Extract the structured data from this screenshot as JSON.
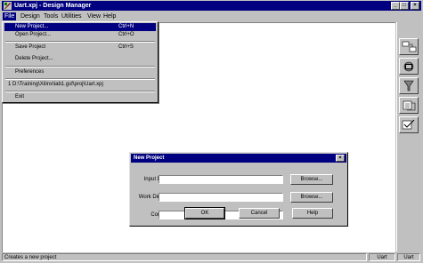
{
  "app": {
    "title": "Uart.xpj - Design Manager"
  },
  "menubar": {
    "items": [
      "File",
      "Design",
      "Tools",
      "Utilities",
      "View",
      "Help"
    ],
    "active_index": 0
  },
  "file_menu": {
    "items": [
      {
        "label": "New Project...",
        "shortcut": "Ctrl+N"
      },
      {
        "label": "Open Project...",
        "shortcut": "Ctrl+O"
      },
      {
        "label": "Save Project",
        "shortcut": "Ctrl+S"
      },
      {
        "label": "Delete Project...",
        "shortcut": ""
      },
      {
        "label": "Preferences",
        "shortcut": ""
      },
      {
        "label": "1 D:\\Training\\Xilinx\\lab1.gsf\\proj\\Uart.xpj",
        "shortcut": ""
      },
      {
        "label": "Exit",
        "shortcut": ""
      }
    ],
    "selected_index": 0
  },
  "toolbar": {
    "tools": [
      "design-entry-icon",
      "implementation-icon",
      "simulation-icon",
      "programming-icon",
      "verification-icon"
    ]
  },
  "dialog": {
    "title": "New Project",
    "close_glyph": "×",
    "fields": [
      {
        "label": "Input Design:",
        "value": "",
        "button": "Browse..."
      },
      {
        "label": "Work Directory:",
        "value": "",
        "button": "Browse..."
      },
      {
        "label": "Comment:",
        "value": ""
      }
    ],
    "buttons": {
      "ok": "OK",
      "cancel": "Cancel",
      "help": "Help"
    }
  },
  "statusbar": {
    "message": "Creates a new project",
    "pane1": "Uart",
    "pane2": "Uart"
  },
  "colors": {
    "titlebar": "#000080",
    "face": "#c0c0c0",
    "workspace": "#ffffff"
  }
}
